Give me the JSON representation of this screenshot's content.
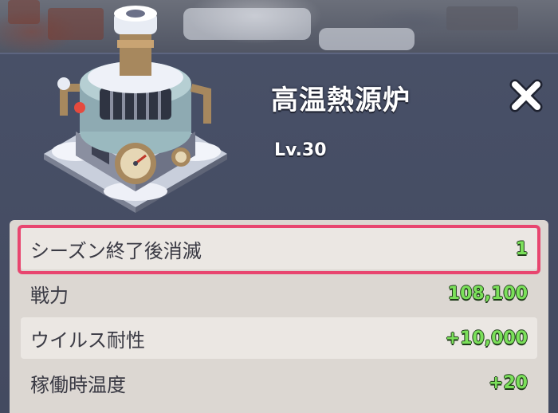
{
  "building": {
    "name": "高温熱源炉",
    "level": "Lv.30",
    "icon": "heat-furnace-icon"
  },
  "close_icon": "close-icon",
  "stats": [
    {
      "label": "シーズン終了後消滅",
      "value": "1",
      "highlighted": true
    },
    {
      "label": "戦力",
      "value": "108,100"
    },
    {
      "label": "ウイルス耐性",
      "value": "+10,000"
    },
    {
      "label": "稼働時温度",
      "value": "+20"
    }
  ],
  "colors": {
    "panel": "#485067",
    "list_bg": "#dcd7d2",
    "value_green": "#7be05a",
    "highlight": "#e8456f"
  }
}
